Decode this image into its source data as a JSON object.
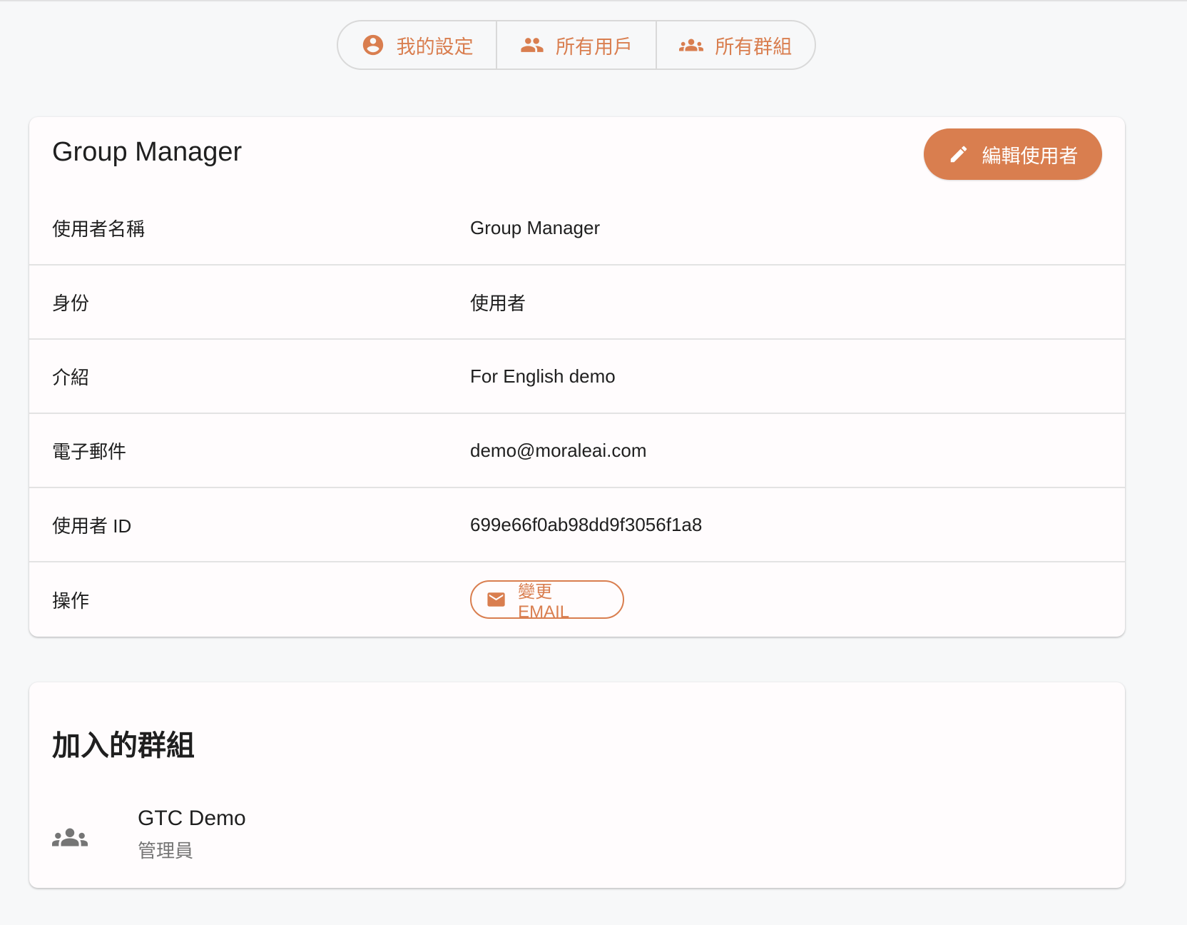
{
  "nav": {
    "tabs": [
      {
        "label": "我的設定",
        "icon": "account-circle-icon"
      },
      {
        "label": "所有用戶",
        "icon": "people-icon"
      },
      {
        "label": "所有群組",
        "icon": "groups-icon"
      }
    ]
  },
  "user_card": {
    "title": "Group Manager",
    "edit_label": "編輯使用者",
    "rows": [
      {
        "label": "使用者名稱",
        "value": "Group Manager"
      },
      {
        "label": "身份",
        "value": "使用者"
      },
      {
        "label": "介紹",
        "value": "For English demo"
      },
      {
        "label": "電子郵件",
        "value": "demo@moraleai.com"
      },
      {
        "label": "使用者 ID",
        "value": "699e66f0ab98dd9f3056f1a8"
      },
      {
        "label": "操作"
      }
    ],
    "change_email_label": "變更 EMAIL"
  },
  "groups_card": {
    "title": "加入的群組",
    "groups": [
      {
        "name": "GTC Demo",
        "role": "管理員"
      }
    ]
  },
  "colors": {
    "accent": "#d97e4f",
    "background": "#f7f8f9",
    "card": "#fffcfd",
    "muted": "#757575"
  }
}
